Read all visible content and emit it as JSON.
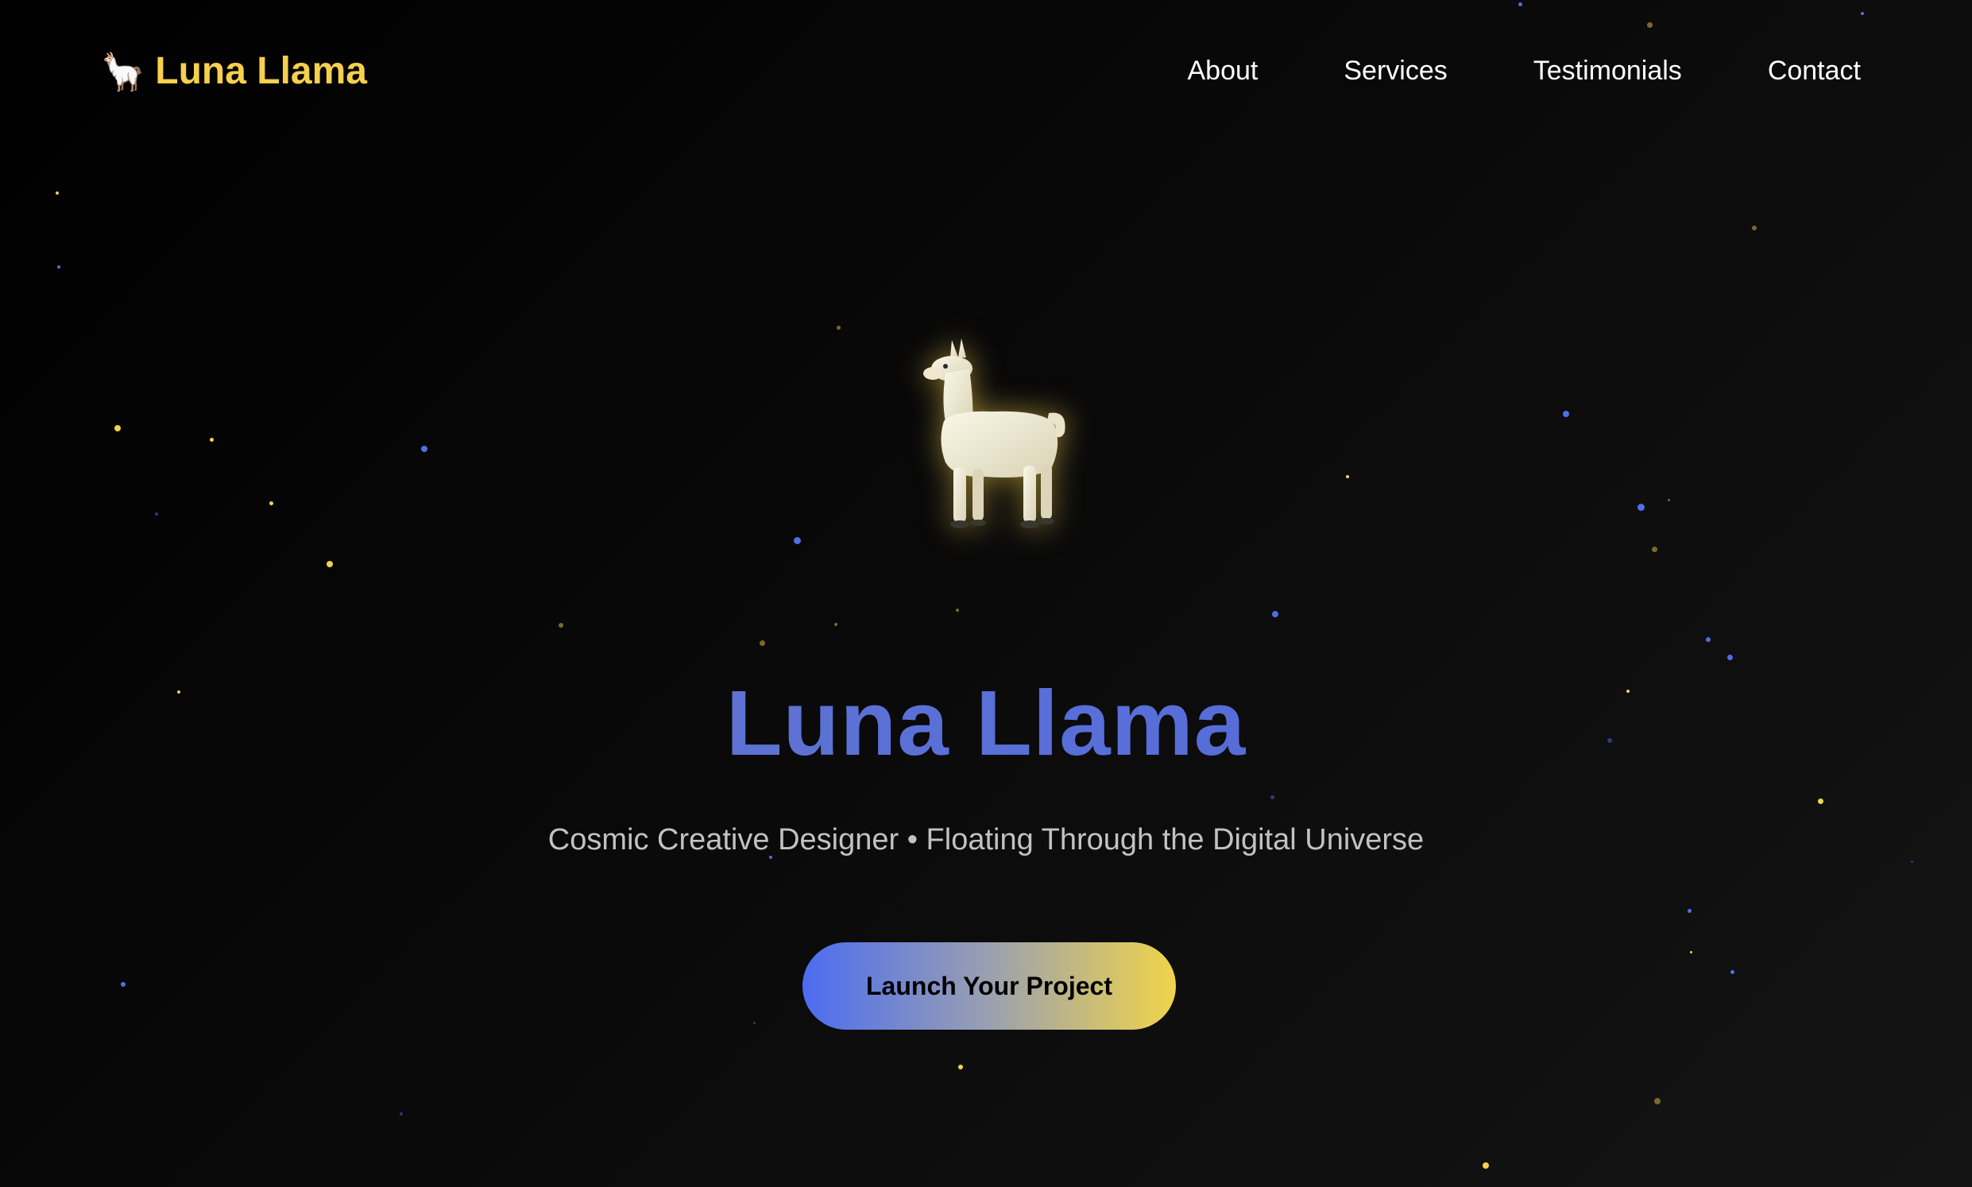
{
  "nav": {
    "logo_icon": "🦙",
    "logo_text": "Luna Llama",
    "items": [
      {
        "label": "About"
      },
      {
        "label": "Services"
      },
      {
        "label": "Testimonials"
      },
      {
        "label": "Contact"
      }
    ]
  },
  "hero": {
    "illustration": "llama-illustration",
    "title": "Luna Llama",
    "subtitle": "Cosmic Creative Designer • Floating Through the Digital Universe",
    "cta_label": "Launch Your Project"
  },
  "colors": {
    "accent_yellow": "#f6d04d",
    "accent_blue": "#4c67de",
    "background": "#0a0a0a"
  }
}
